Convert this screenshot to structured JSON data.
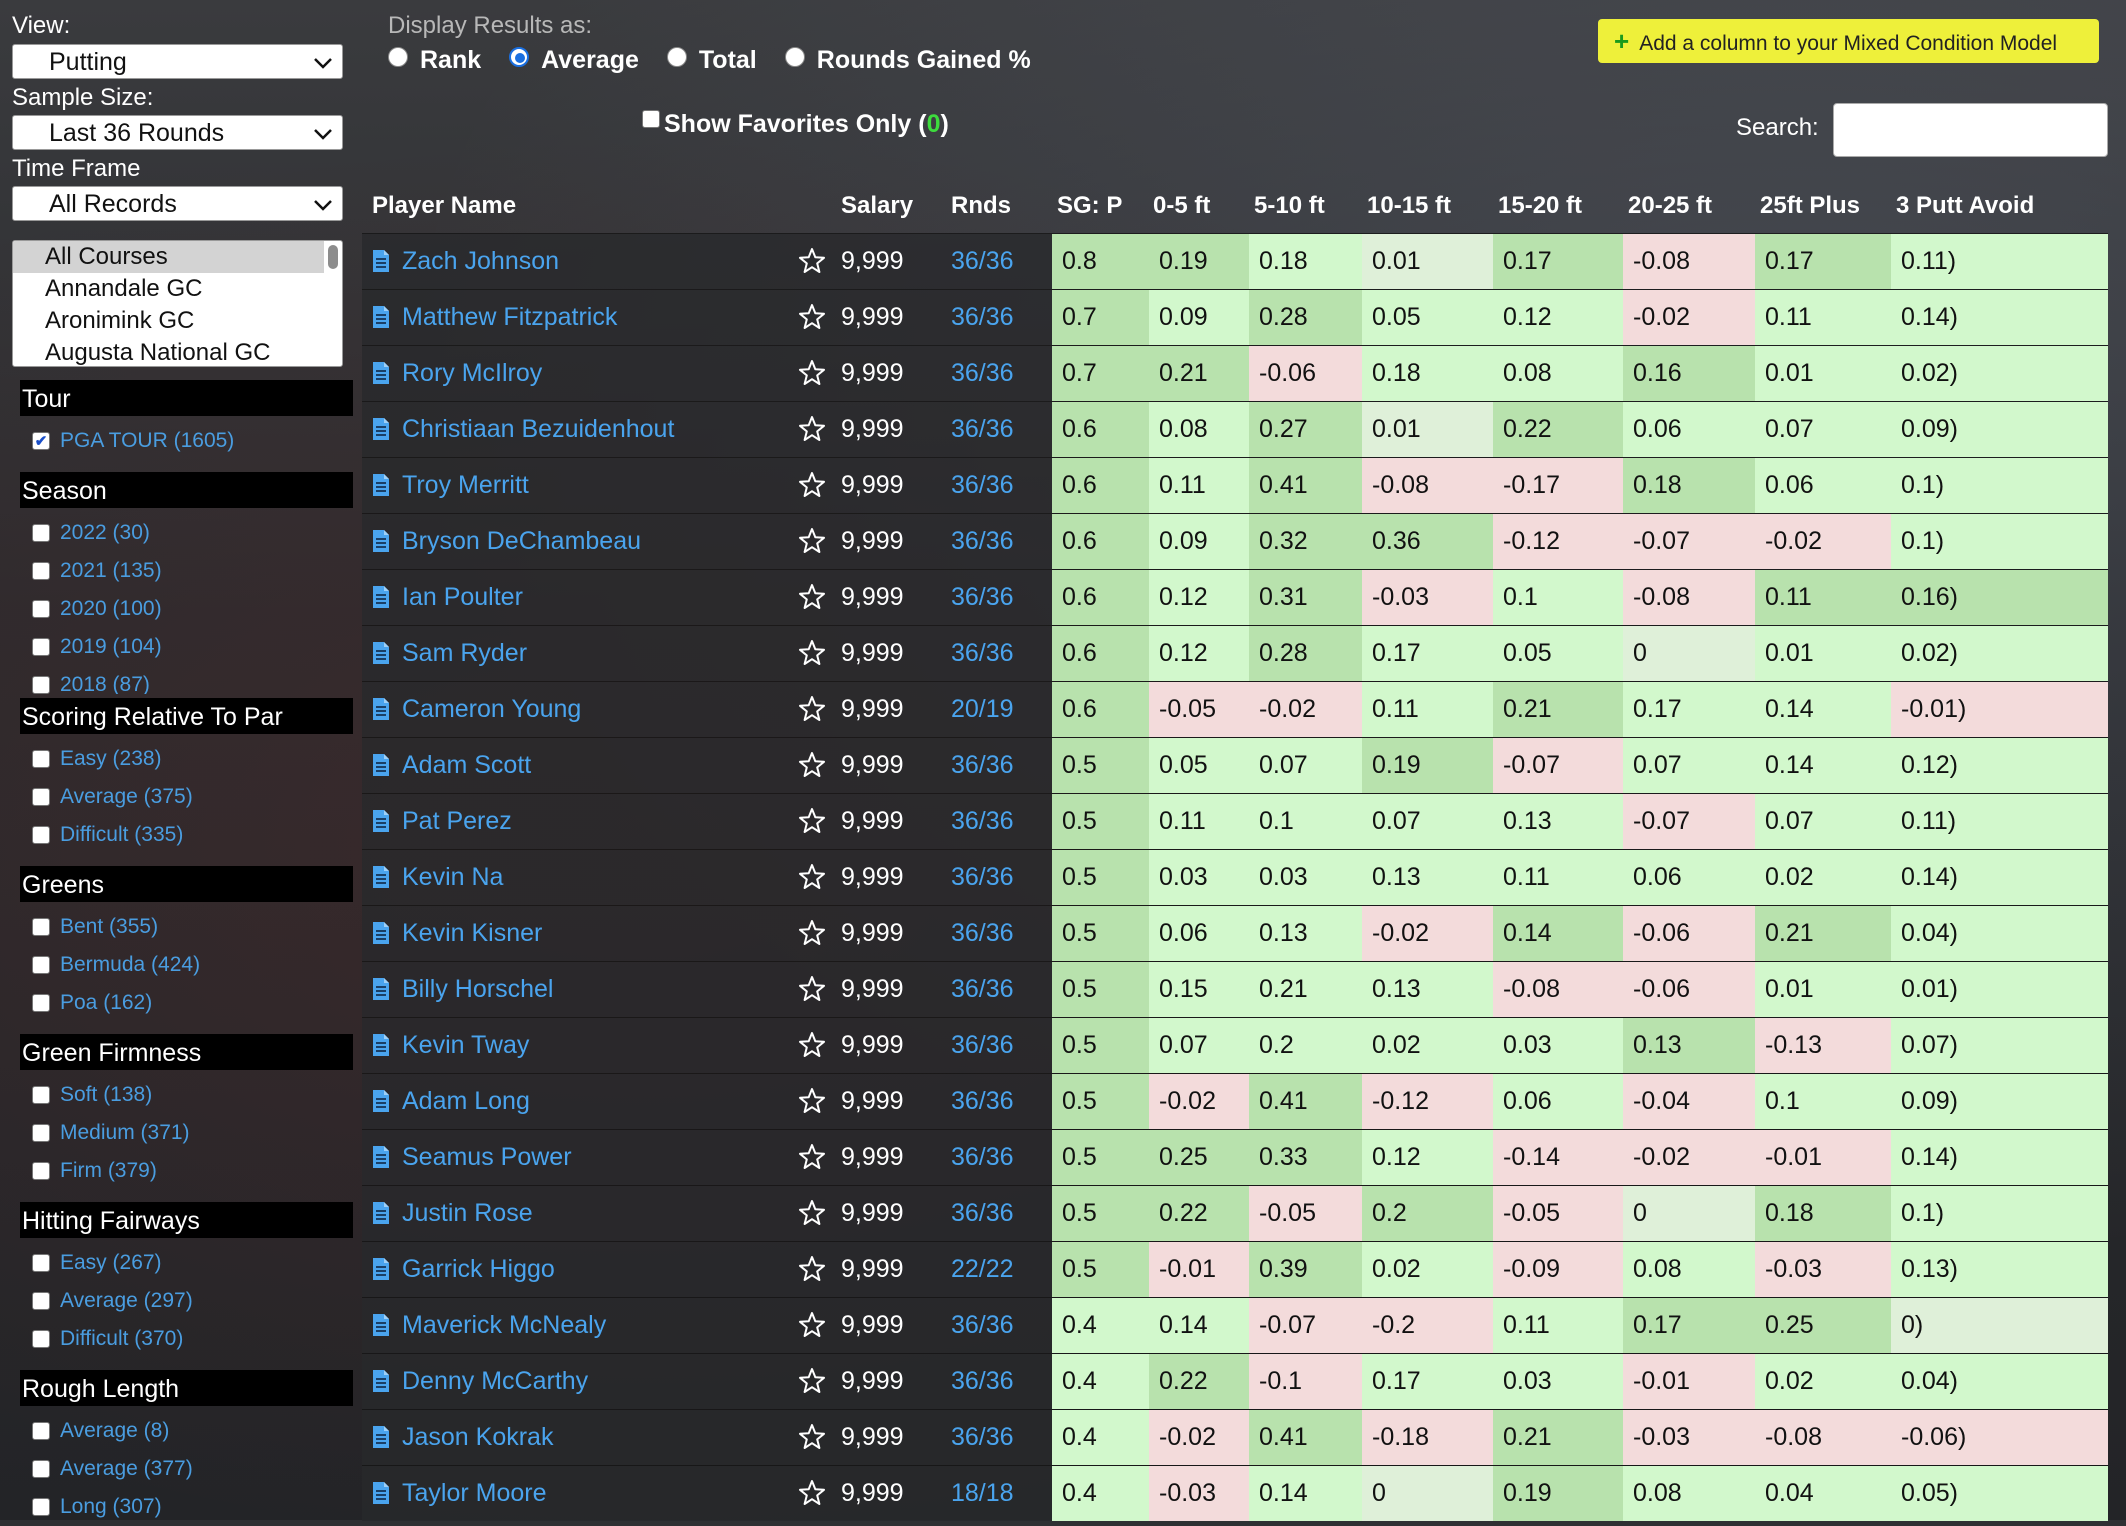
{
  "colors": {
    "green_strong": "#b8e2ad",
    "green_light": "#d2f8cc",
    "neutral": "#dff0d9",
    "red_light": "#f3dbdb",
    "link": "#4aa4ee",
    "accent_button": "#eef03a"
  },
  "sidebar": {
    "view_label": "View:",
    "view_value": "Putting",
    "sample_label": "Sample Size:",
    "sample_value": "Last 36 Rounds",
    "timeframe_label": "Time Frame",
    "timeframe_value": "All Records",
    "courses": [
      "All Courses",
      "Annandale GC",
      "Aronimink GC",
      "Augusta National GC"
    ],
    "sections": [
      {
        "title": "Tour",
        "items": [
          {
            "label": "PGA TOUR (1605)",
            "checked": true
          }
        ]
      },
      {
        "title": "Season",
        "items": [
          {
            "label": "2022 (30)",
            "checked": false
          },
          {
            "label": "2021 (135)",
            "checked": false
          },
          {
            "label": "2020 (100)",
            "checked": false
          },
          {
            "label": "2019 (104)",
            "checked": false
          },
          {
            "label": "2018 (87)",
            "checked": false
          }
        ]
      },
      {
        "title": "Scoring Relative To Par",
        "items": [
          {
            "label": "Easy (238)",
            "checked": false
          },
          {
            "label": "Average (375)",
            "checked": false
          },
          {
            "label": "Difficult (335)",
            "checked": false
          }
        ]
      },
      {
        "title": "Greens",
        "items": [
          {
            "label": "Bent (355)",
            "checked": false
          },
          {
            "label": "Bermuda (424)",
            "checked": false
          },
          {
            "label": "Poa (162)",
            "checked": false
          }
        ]
      },
      {
        "title": "Green Firmness",
        "items": [
          {
            "label": "Soft (138)",
            "checked": false
          },
          {
            "label": "Medium (371)",
            "checked": false
          },
          {
            "label": "Firm (379)",
            "checked": false
          }
        ]
      },
      {
        "title": "Hitting Fairways",
        "items": [
          {
            "label": "Easy (267)",
            "checked": false
          },
          {
            "label": "Average (297)",
            "checked": false
          },
          {
            "label": "Difficult (370)",
            "checked": false
          }
        ]
      },
      {
        "title": "Rough Length",
        "items": [
          {
            "label": "Average (8)",
            "checked": false
          },
          {
            "label": "Average (377)",
            "checked": false
          },
          {
            "label": "Long (307)",
            "checked": false
          }
        ]
      }
    ]
  },
  "top": {
    "display_label": "Display Results as:",
    "radios": [
      {
        "label": "Rank",
        "selected": false
      },
      {
        "label": "Average",
        "selected": true
      },
      {
        "label": "Total",
        "selected": false
      },
      {
        "label": "Rounds Gained %",
        "selected": false
      }
    ],
    "favorites_label": "Show Favorites Only (",
    "favorites_count": "0",
    "favorites_close": ")",
    "add_column_label": "Add a column to your Mixed Condition Model",
    "add_column_plus": "+",
    "search_label": "Search:",
    "search_value": ""
  },
  "table": {
    "headers": [
      "Player Name",
      "Salary",
      "Rnds",
      "SG: P",
      "0-5 ft",
      "5-10 ft",
      "10-15 ft",
      "15-20 ft",
      "20-25 ft",
      "25ft Plus",
      "3 Putt Avoid"
    ],
    "rows": [
      {
        "name": "Zach Johnson",
        "salary": "9,999",
        "rnds": "36/36",
        "vals": [
          "0.8",
          "0.19",
          "0.18",
          "0.01",
          "0.17",
          "-0.08",
          "0.17",
          "0.11)"
        ],
        "shades": [
          "gs",
          "gs",
          "gl",
          "nt",
          "gs",
          "rl",
          "gs",
          "gl"
        ]
      },
      {
        "name": "Matthew Fitzpatrick",
        "salary": "9,999",
        "rnds": "36/36",
        "vals": [
          "0.7",
          "0.09",
          "0.28",
          "0.05",
          "0.12",
          "-0.02",
          "0.11",
          "0.14)"
        ],
        "shades": [
          "gs",
          "gl",
          "gs",
          "gl",
          "gl",
          "rl",
          "gl",
          "gl"
        ]
      },
      {
        "name": "Rory McIlroy",
        "salary": "9,999",
        "rnds": "36/36",
        "vals": [
          "0.7",
          "0.21",
          "-0.06",
          "0.18",
          "0.08",
          "0.16",
          "0.01",
          "0.02)"
        ],
        "shades": [
          "gs",
          "gs",
          "rl",
          "gl",
          "gl",
          "gs",
          "gl",
          "gl"
        ]
      },
      {
        "name": "Christiaan Bezuidenhout",
        "salary": "9,999",
        "rnds": "36/36",
        "vals": [
          "0.6",
          "0.08",
          "0.27",
          "0.01",
          "0.22",
          "0.06",
          "0.07",
          "0.09)"
        ],
        "shades": [
          "gs",
          "gl",
          "gs",
          "nt",
          "gs",
          "gl",
          "gl",
          "gl"
        ]
      },
      {
        "name": "Troy Merritt",
        "salary": "9,999",
        "rnds": "36/36",
        "vals": [
          "0.6",
          "0.11",
          "0.41",
          "-0.08",
          "-0.17",
          "0.18",
          "0.06",
          "0.1)"
        ],
        "shades": [
          "gs",
          "gl",
          "gs",
          "rl",
          "rl",
          "gs",
          "gl",
          "gl"
        ]
      },
      {
        "name": "Bryson DeChambeau",
        "salary": "9,999",
        "rnds": "36/36",
        "vals": [
          "0.6",
          "0.09",
          "0.32",
          "0.36",
          "-0.12",
          "-0.07",
          "-0.02",
          "0.1)"
        ],
        "shades": [
          "gs",
          "gl",
          "gs",
          "gs",
          "rl",
          "rl",
          "rl",
          "gl"
        ]
      },
      {
        "name": "Ian Poulter",
        "salary": "9,999",
        "rnds": "36/36",
        "vals": [
          "0.6",
          "0.12",
          "0.31",
          "-0.03",
          "0.1",
          "-0.08",
          "0.11",
          "0.16)"
        ],
        "shades": [
          "gs",
          "gl",
          "gs",
          "rl",
          "gl",
          "rl",
          "gs",
          "gs"
        ]
      },
      {
        "name": "Sam Ryder",
        "salary": "9,999",
        "rnds": "36/36",
        "vals": [
          "0.6",
          "0.12",
          "0.28",
          "0.17",
          "0.05",
          "0",
          "0.01",
          "0.02)"
        ],
        "shades": [
          "gs",
          "gl",
          "gs",
          "gl",
          "gl",
          "nt",
          "gl",
          "gl"
        ]
      },
      {
        "name": "Cameron Young",
        "salary": "9,999",
        "rnds": "20/19",
        "vals": [
          "0.6",
          "-0.05",
          "-0.02",
          "0.11",
          "0.21",
          "0.17",
          "0.14",
          "-0.01)"
        ],
        "shades": [
          "gs",
          "rl",
          "rl",
          "gl",
          "gs",
          "gl",
          "gl",
          "rl"
        ]
      },
      {
        "name": "Adam Scott",
        "salary": "9,999",
        "rnds": "36/36",
        "vals": [
          "0.5",
          "0.05",
          "0.07",
          "0.19",
          "-0.07",
          "0.07",
          "0.14",
          "0.12)"
        ],
        "shades": [
          "gs",
          "gl",
          "gl",
          "gs",
          "rl",
          "gl",
          "gl",
          "gl"
        ]
      },
      {
        "name": "Pat Perez",
        "salary": "9,999",
        "rnds": "36/36",
        "vals": [
          "0.5",
          "0.11",
          "0.1",
          "0.07",
          "0.13",
          "-0.07",
          "0.07",
          "0.11)"
        ],
        "shades": [
          "gs",
          "gl",
          "gl",
          "gl",
          "gl",
          "rl",
          "gl",
          "gl"
        ]
      },
      {
        "name": "Kevin Na",
        "salary": "9,999",
        "rnds": "36/36",
        "vals": [
          "0.5",
          "0.03",
          "0.03",
          "0.13",
          "0.11",
          "0.06",
          "0.02",
          "0.14)"
        ],
        "shades": [
          "gs",
          "gl",
          "gl",
          "gl",
          "gl",
          "gl",
          "gl",
          "gl"
        ]
      },
      {
        "name": "Kevin Kisner",
        "salary": "9,999",
        "rnds": "36/36",
        "vals": [
          "0.5",
          "0.06",
          "0.13",
          "-0.02",
          "0.14",
          "-0.06",
          "0.21",
          "0.04)"
        ],
        "shades": [
          "gs",
          "gl",
          "gl",
          "rl",
          "gs",
          "rl",
          "gs",
          "gl"
        ]
      },
      {
        "name": "Billy Horschel",
        "salary": "9,999",
        "rnds": "36/36",
        "vals": [
          "0.5",
          "0.15",
          "0.21",
          "0.13",
          "-0.08",
          "-0.06",
          "0.01",
          "0.01)"
        ],
        "shades": [
          "gs",
          "gl",
          "gl",
          "gl",
          "rl",
          "rl",
          "gl",
          "gl"
        ]
      },
      {
        "name": "Kevin Tway",
        "salary": "9,999",
        "rnds": "36/36",
        "vals": [
          "0.5",
          "0.07",
          "0.2",
          "0.02",
          "0.03",
          "0.13",
          "-0.13",
          "0.07)"
        ],
        "shades": [
          "gs",
          "gl",
          "gl",
          "gl",
          "gl",
          "gs",
          "rl",
          "gl"
        ]
      },
      {
        "name": "Adam Long",
        "salary": "9,999",
        "rnds": "36/36",
        "vals": [
          "0.5",
          "-0.02",
          "0.41",
          "-0.12",
          "0.06",
          "-0.04",
          "0.1",
          "0.09)"
        ],
        "shades": [
          "gs",
          "rl",
          "gs",
          "rl",
          "gl",
          "rl",
          "gl",
          "gl"
        ]
      },
      {
        "name": "Seamus Power",
        "salary": "9,999",
        "rnds": "36/36",
        "vals": [
          "0.5",
          "0.25",
          "0.33",
          "0.12",
          "-0.14",
          "-0.02",
          "-0.01",
          "0.14)"
        ],
        "shades": [
          "gs",
          "gs",
          "gs",
          "gl",
          "rl",
          "rl",
          "rl",
          "gl"
        ]
      },
      {
        "name": "Justin Rose",
        "salary": "9,999",
        "rnds": "36/36",
        "vals": [
          "0.5",
          "0.22",
          "-0.05",
          "0.2",
          "-0.05",
          "0",
          "0.18",
          "0.1)"
        ],
        "shades": [
          "gs",
          "gs",
          "rl",
          "gs",
          "rl",
          "nt",
          "gs",
          "gl"
        ]
      },
      {
        "name": "Garrick Higgo",
        "salary": "9,999",
        "rnds": "22/22",
        "vals": [
          "0.5",
          "-0.01",
          "0.39",
          "0.02",
          "-0.09",
          "0.08",
          "-0.03",
          "0.13)"
        ],
        "shades": [
          "gs",
          "rl",
          "gs",
          "gl",
          "rl",
          "gl",
          "rl",
          "gl"
        ]
      },
      {
        "name": "Maverick McNealy",
        "salary": "9,999",
        "rnds": "36/36",
        "vals": [
          "0.4",
          "0.14",
          "-0.07",
          "-0.2",
          "0.11",
          "0.17",
          "0.25",
          "0)"
        ],
        "shades": [
          "gl",
          "gl",
          "rl",
          "rl",
          "gl",
          "gs",
          "gs",
          "nt"
        ]
      },
      {
        "name": "Denny McCarthy",
        "salary": "9,999",
        "rnds": "36/36",
        "vals": [
          "0.4",
          "0.22",
          "-0.1",
          "0.17",
          "0.03",
          "-0.01",
          "0.02",
          "0.04)"
        ],
        "shades": [
          "gl",
          "gs",
          "rl",
          "gl",
          "gl",
          "rl",
          "gl",
          "gl"
        ]
      },
      {
        "name": "Jason Kokrak",
        "salary": "9,999",
        "rnds": "36/36",
        "vals": [
          "0.4",
          "-0.02",
          "0.41",
          "-0.18",
          "0.21",
          "-0.03",
          "-0.08",
          "-0.06)"
        ],
        "shades": [
          "gl",
          "rl",
          "gs",
          "rl",
          "gs",
          "rl",
          "rl",
          "rl"
        ]
      },
      {
        "name": "Taylor Moore",
        "salary": "9,999",
        "rnds": "18/18",
        "vals": [
          "0.4",
          "-0.03",
          "0.14",
          "0",
          "0.19",
          "0.08",
          "0.04",
          "0.05)"
        ],
        "shades": [
          "gl",
          "rl",
          "gl",
          "nt",
          "gs",
          "gl",
          "gl",
          "gl"
        ]
      }
    ]
  }
}
